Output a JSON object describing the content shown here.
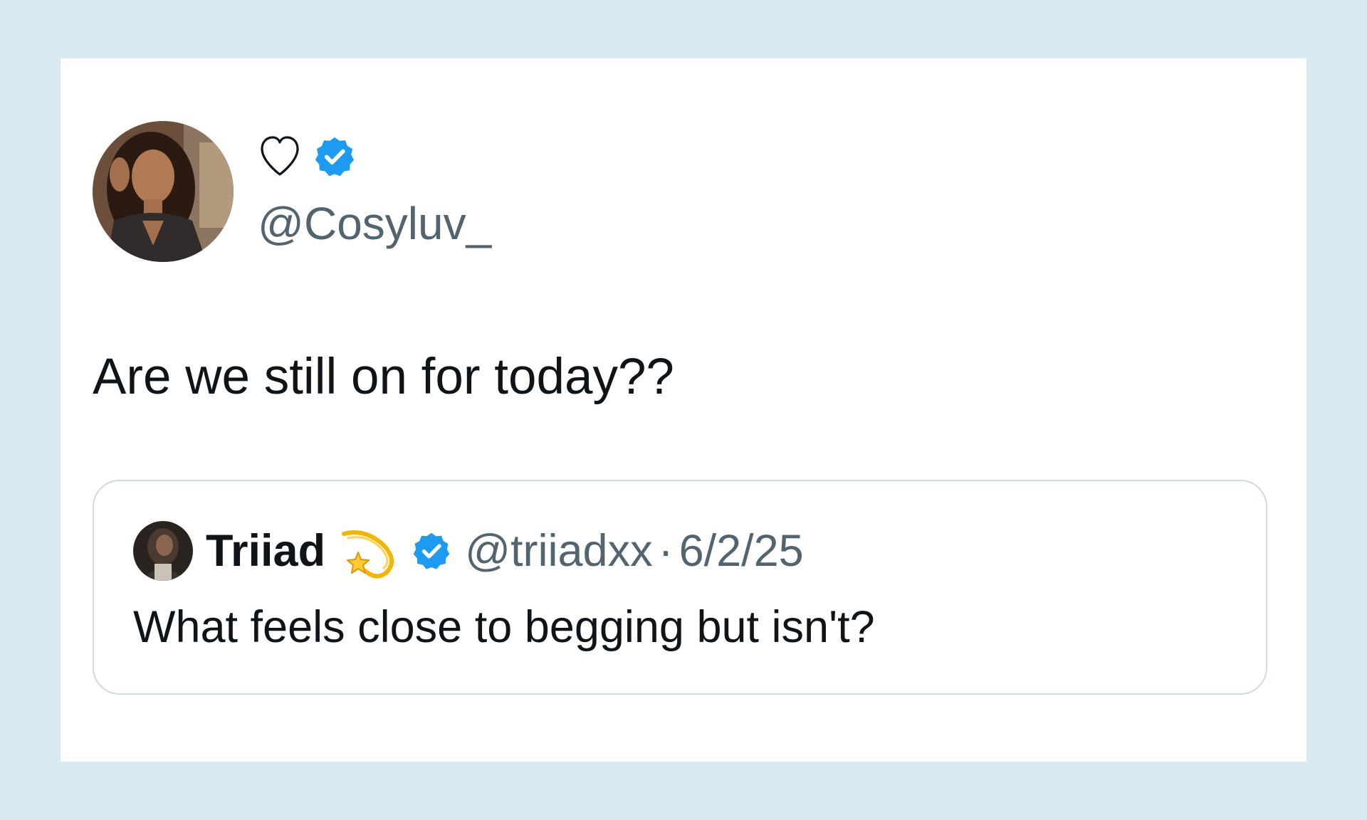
{
  "tweet": {
    "author": {
      "display_name_icon": "heart-outline-icon",
      "verified_icon": "verified-badge-icon",
      "handle": "@Cosyluv_"
    },
    "text": "Are we still on for today??",
    "quoted_tweet": {
      "author": {
        "display_name": "Triiad",
        "emoji": "dizzy-star-icon",
        "verified_icon": "verified-badge-icon",
        "handle": "@triiadxx",
        "separator": "·",
        "date": "6/2/25"
      },
      "text": "What feels close to begging but isn't?"
    }
  },
  "colors": {
    "page_background": "#d8e9f0",
    "card_background": "#ffffff",
    "verified_blue": "#1d9bf0",
    "primary_text": "#0f1419",
    "secondary_text": "#536471",
    "border": "#cfd9de"
  }
}
